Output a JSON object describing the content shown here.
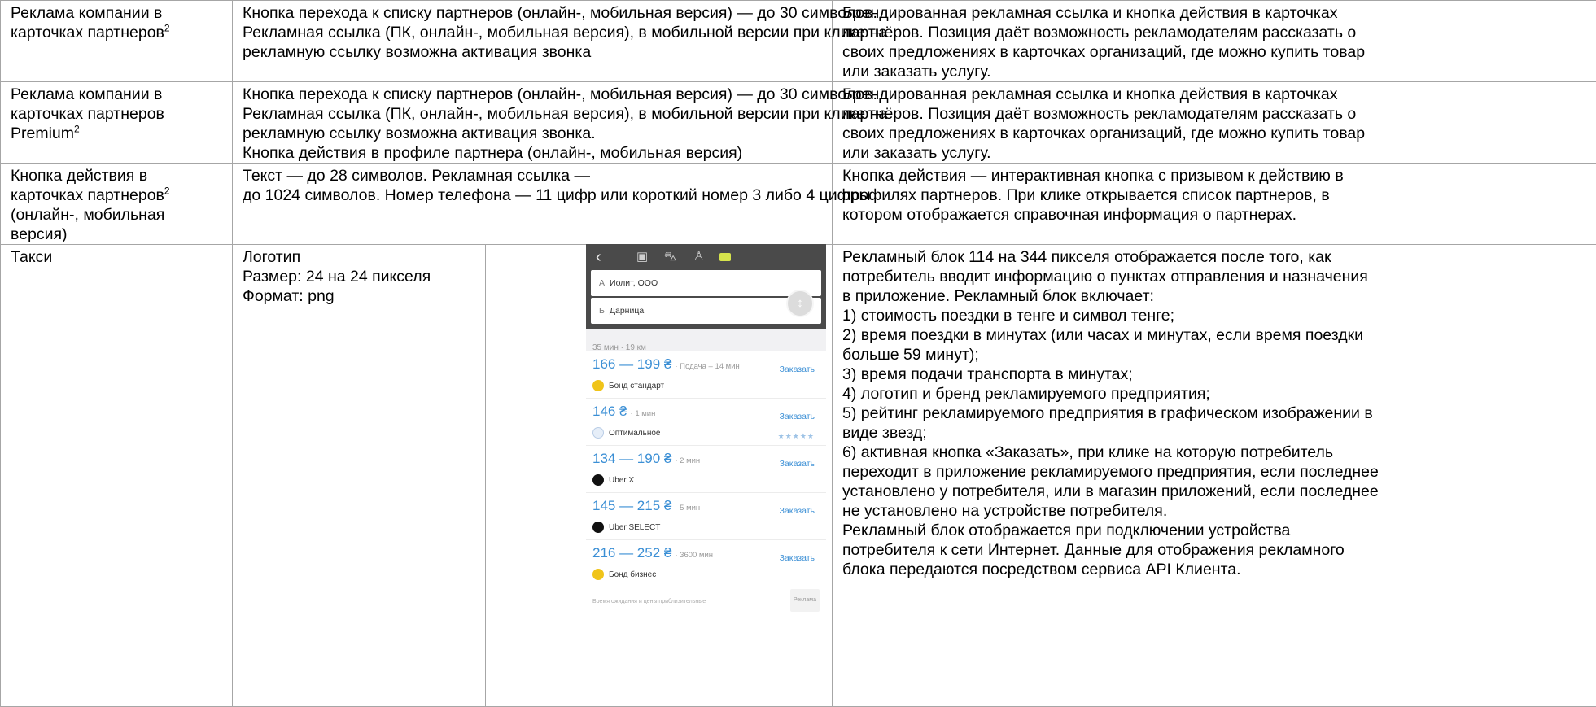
{
  "rows": [
    {
      "name_lines": [
        "Реклама компании в",
        "карточках партнеров"
      ],
      "name_sup": "2",
      "desc_lines": [
        "Кнопка перехода к списку партнеров (онлайн-, мобильная версия) — до 30 символов.",
        "Рекламная ссылка (ПК, онлайн-, мобильная версия), в мобильной версии при клике на",
        "рекламную ссылку возможна активация звонка"
      ],
      "note_lines": [
        "Брендированная рекламная ссылка и кнопка действия в карточках",
        "партнёров. Позиция даёт возможность рекламодателям рассказать о",
        "своих предложениях в карточках организаций, где можно купить товар",
        "или заказать услугу."
      ]
    },
    {
      "name_lines": [
        "Реклама компании в",
        "карточках партнеров",
        "Premium"
      ],
      "name_sup": "2",
      "desc_lines": [
        "Кнопка перехода к списку партнеров (онлайн-, мобильная версия) — до 30 символов.",
        "Рекламная ссылка (ПК, онлайн-, мобильная версия), в мобильной версии при клике на",
        "рекламную ссылку возможна активация звонка.",
        "Кнопка действия в профиле партнера (онлайн-, мобильная версия)"
      ],
      "note_lines": [
        "Брендированная рекламная ссылка и кнопка действия в карточках",
        "партнёров. Позиция даёт возможность рекламодателям рассказать о",
        "своих предложениях в карточках организаций, где можно купить товар",
        "или заказать услугу."
      ]
    },
    {
      "name_lines": [
        "Кнопка действия в",
        "карточках партнеров",
        "(онлайн-, мобильная",
        "версия)"
      ],
      "name_sup": "2",
      "desc_lines": [
        "Текст — до 28 символов. Рекламная ссылка —",
        "до 1024 символов. Номер телефона — 11 цифр или короткий номер 3 либо 4 цифры."
      ],
      "note_lines": [
        "Кнопка действия — интерактивная кнопка с призывом к действию в",
        "профилях партнеров. При клике открывается список партнеров, в",
        "котором отображается справочная информация о партнерах."
      ]
    },
    {
      "name_lines": [
        "Такси"
      ],
      "desc_lines": [
        "Логотип",
        "Размер: 24 на 24 пикселя",
        "Формат: png"
      ],
      "note_lines": [
        "Рекламный блок 114 на 344 пикселя отображается после того, как",
        "потребитель вводит информацию о пунктах отправления и назначения",
        "в приложение. Рекламный блок включает:",
        "1) стоимость поездки в тенге и символ тенге;",
        "2) время поездки в минутах (или часах и минутах, если время поездки",
        "больше 59 минут);",
        "3) время подачи транспорта в минутах;",
        "4) логотип и бренд рекламируемого предприятия;",
        "5) рейтинг рекламируемого предприятия в графическом изображении в",
        "виде звезд;",
        "6) активная кнопка «Заказать», при клике на которую потребитель",
        "переходит в приложение рекламируемого предприятия, если последнее",
        "установлено у потребителя, или в магазин приложений, если последнее",
        "не установлено на устройстве потребителя.",
        "Рекламный блок отображается при подключении устройства",
        "потребителя к сети Интернет. Данные для отображения рекламного",
        "блока передаются посредством сервиса API Клиента."
      ]
    }
  ],
  "phone": {
    "icons": [
      "back-icon",
      "bus-icon",
      "car-icon",
      "walk-icon",
      "taxi-icon"
    ],
    "from_key": "А",
    "from_value": "Иолит, ООО",
    "to_key": "Б",
    "to_value": "Дарница",
    "route_info": "35 мин · 19 км",
    "order_label": "Заказать",
    "options": [
      {
        "price": "166 — 199 ₴",
        "meta": "· Подача – 14 мин",
        "brand": "Бонд стандарт",
        "logo": "yellow",
        "stars": ""
      },
      {
        "price": "146 ₴",
        "meta": "· 1 мин",
        "brand": "Оптимальное",
        "logo": "blue",
        "stars": "★★★★★"
      },
      {
        "price": "134 — 190 ₴",
        "meta": "· 2 мин",
        "brand": "Uber X",
        "logo": "black",
        "stars": ""
      },
      {
        "price": "145 — 215 ₴",
        "meta": "· 5 мин",
        "brand": "Uber SELECT",
        "logo": "black",
        "stars": ""
      },
      {
        "price": "216 — 252 ₴",
        "meta": "· 3600 мин",
        "brand": "Бонд бизнес",
        "logo": "yellow",
        "stars": ""
      }
    ],
    "footer_note": "Время ожидания и цены приблизительные",
    "ad_tag": "Реклама"
  }
}
